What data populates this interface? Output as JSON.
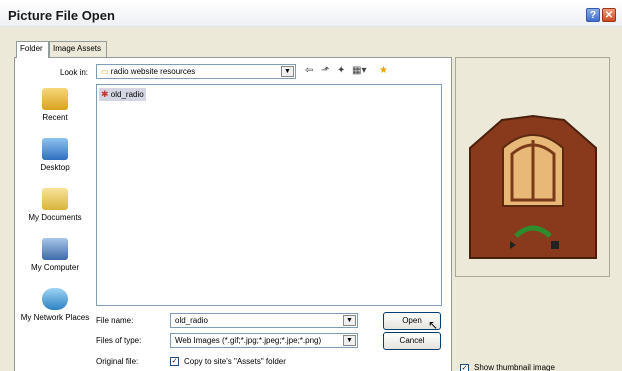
{
  "window": {
    "title": "Picture File Open"
  },
  "tabs": [
    {
      "label": "Folder"
    },
    {
      "label": "Image Assets"
    }
  ],
  "look_in": {
    "label": "Look in:",
    "value": "radio website resources"
  },
  "places": [
    {
      "label": "Recent",
      "icon": "recent-folder-icon"
    },
    {
      "label": "Desktop",
      "icon": "desktop-icon"
    },
    {
      "label": "My Documents",
      "icon": "my-documents-icon"
    },
    {
      "label": "My Computer",
      "icon": "my-computer-icon"
    },
    {
      "label": "My Network Places",
      "icon": "network-places-icon"
    }
  ],
  "files": [
    {
      "name": "old_radio"
    }
  ],
  "file_name": {
    "label": "File name:",
    "value": "old_radio"
  },
  "file_type": {
    "label": "Files of type:",
    "value": "Web Images (*.gif;*.jpg;*.jpeg;*.jpe;*.png)"
  },
  "original_file": {
    "label": "Original file:",
    "checkbox_label": "Copy to site's \"Assets\" folder",
    "checked": true
  },
  "buttons": {
    "open": "Open",
    "cancel": "Cancel"
  },
  "preview": {
    "show_thumbnail_label": "Show thumbnail image",
    "checked": true,
    "image": "old-radio-icon"
  },
  "colors": {
    "radio_wood": "#8a3a1c",
    "radio_dial": "#e8b878",
    "radio_arc": "#2e8b2e"
  }
}
